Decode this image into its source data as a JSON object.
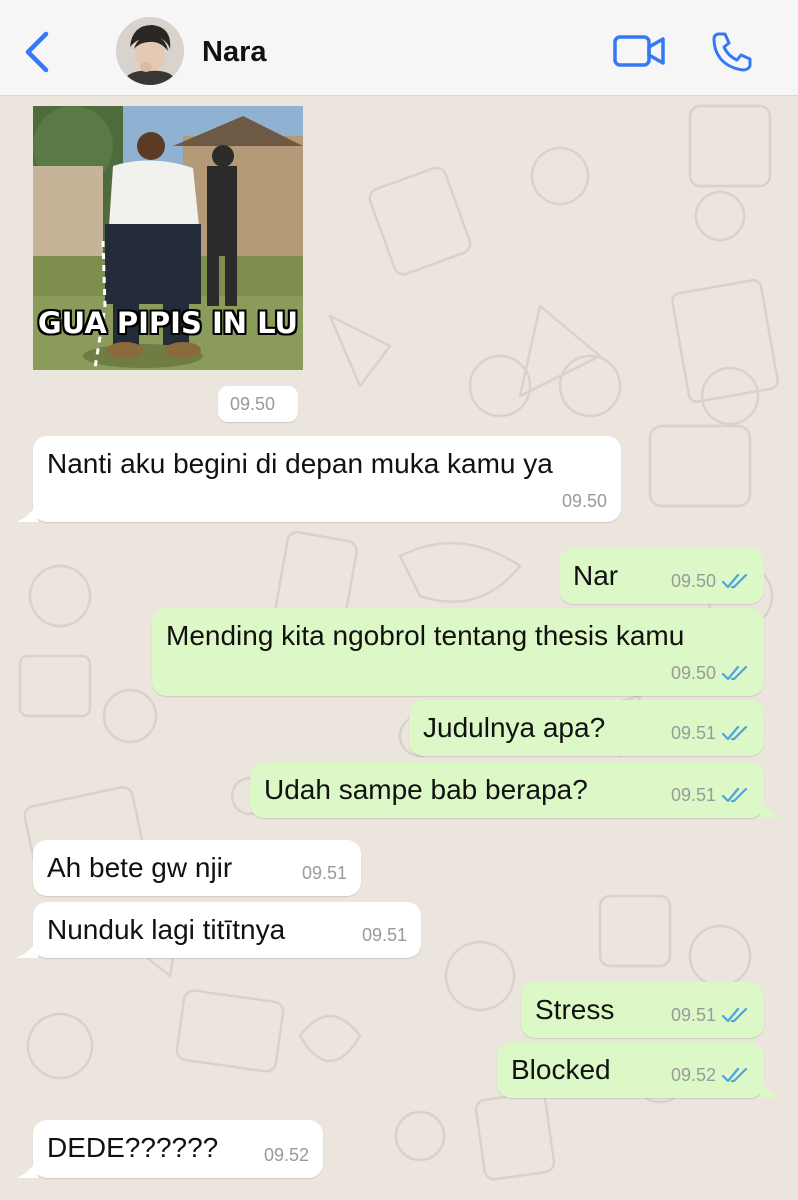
{
  "header": {
    "contact_name": "Nara",
    "back_icon": "chevron-left-icon",
    "video_icon": "video-camera-icon",
    "call_icon": "phone-icon"
  },
  "colors": {
    "accent": "#3478f6",
    "incoming_bubble": "#ffffff",
    "outgoing_bubble": "#dbf8c6",
    "wallpaper": "#ebe5de",
    "read_ticks": "#4fa3e0"
  },
  "image_message": {
    "caption": "GUA PIPIS IN LU",
    "time": "09.50"
  },
  "messages": [
    {
      "direction": "in",
      "text": "Nanti aku begini di depan muka kamu ya",
      "time": "09.50"
    },
    {
      "direction": "out",
      "text": "Nar",
      "time": "09.50",
      "status": "read"
    },
    {
      "direction": "out",
      "text": "Mending kita ngobrol tentang thesis kamu",
      "time": "09.50",
      "status": "read"
    },
    {
      "direction": "out",
      "text": "Judulnya apa?",
      "time": "09.51",
      "status": "read"
    },
    {
      "direction": "out",
      "text": "Udah sampe bab berapa?",
      "time": "09.51",
      "status": "read"
    },
    {
      "direction": "in",
      "text": "Ah bete gw njir",
      "time": "09.51"
    },
    {
      "direction": "in",
      "text": "Nunduk lagi titītnya",
      "time": "09.51"
    },
    {
      "direction": "out",
      "text": "Stress",
      "time": "09.51",
      "status": "read"
    },
    {
      "direction": "out",
      "text": "Blocked",
      "time": "09.52",
      "status": "read"
    },
    {
      "direction": "in",
      "text": "DEDE??????",
      "time": "09.52"
    }
  ]
}
